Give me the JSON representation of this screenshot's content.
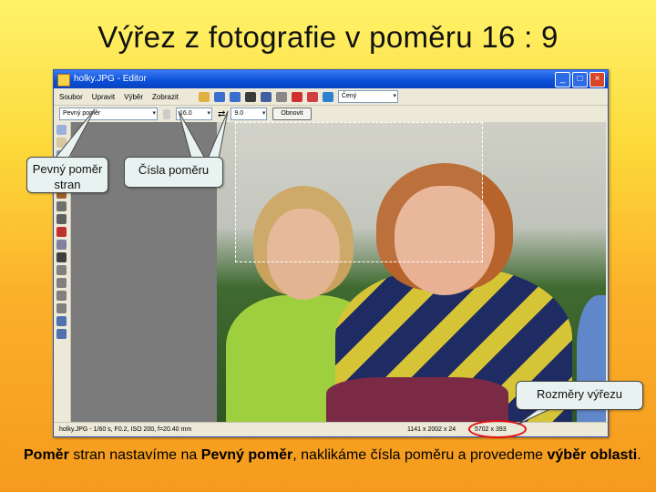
{
  "slide": {
    "title": "Výřez z fotografie v poměru 16 : 9"
  },
  "window": {
    "title": "holky.JPG - Editor",
    "buttons": [
      "_",
      "□",
      "×"
    ],
    "menu": [
      "Soubor",
      "Upravit",
      "Výběr",
      "Zobrazit"
    ],
    "color_combo": "Čený",
    "ratio_combo": "Pevný poměr",
    "ratio_a": "16.0",
    "ratio_b": "9.0",
    "reset_button": "Obnovit",
    "status_file": "holky.JPG - 1/60 s, F0.2, ISO 200, f=20.40 mm",
    "status_size": "1141 x 2002 x 24",
    "status_selection": "5702 x 393"
  },
  "callouts": {
    "fixed_ratio": "Pevný poměr stran",
    "ratio_numbers": "Čísla poměru",
    "crop_size": "Rozměry výřezu"
  },
  "caption": {
    "p1": "Poměr",
    "p2": " stran nastavíme na ",
    "p3": "Pevný poměr",
    "p4": ", naklikáme čísla poměru a provedeme ",
    "p5": "výběr oblasti",
    "p6": "."
  },
  "colors": {
    "accent_red": "#e01010",
    "window_blue": "#0a4fd8"
  }
}
